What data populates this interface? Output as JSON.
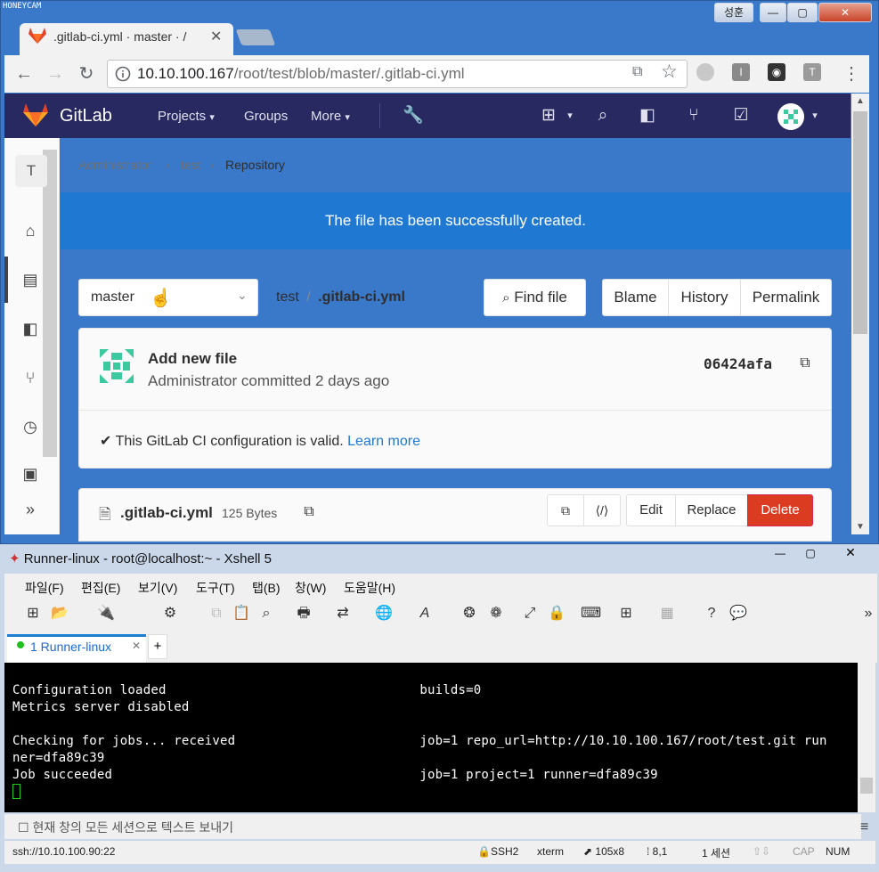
{
  "chrome": {
    "badge": "HONEYCAM",
    "tab_title": ".gitlab-ci.yml · master · /",
    "tab_close": "✕",
    "user_label": "성훈",
    "url_host": "10.10.100.167",
    "url_path": "/root/test/blob/master/.gitlab-ci.yml"
  },
  "gitlab": {
    "brand": "GitLab",
    "nav": [
      "Projects",
      "Groups",
      "More"
    ],
    "sidebar_avatar": "T",
    "breadcrumb": [
      "Administrator",
      "test",
      "Repository"
    ],
    "flash": "The file has been successfully created.",
    "branch": "master",
    "path_project": "test",
    "path_sep": "/",
    "path_file": ".gitlab-ci.yml",
    "find_file": "Find file",
    "blame": "Blame",
    "history": "History",
    "permalink": "Permalink",
    "commit_title": "Add new file",
    "commit_sub": "Administrator committed 2 days ago",
    "sha": "06424afa",
    "ci_text": "This GitLab CI configuration is valid.",
    "ci_link": "Learn more",
    "file_name": ".gitlab-ci.yml",
    "file_size": "125 Bytes",
    "edit": "Edit",
    "replace": "Replace",
    "delete": "Delete"
  },
  "xshell": {
    "title": "Runner-linux - root@localhost:~ - Xshell 5",
    "menu": [
      "파일(F)",
      "편집(E)",
      "보기(V)",
      "도구(T)",
      "탭(B)",
      "창(W)",
      "도움말(H)"
    ],
    "tab": "1 Runner-linux",
    "terminal": [
      "Configuration loaded                                 builds=0",
      "Metrics server disabled",
      "",
      "Checking for jobs... received                        job=1 repo_url=http://10.10.100.167/root/test.git run",
      "ner=dfa89c39",
      "Job succeeded                                        job=1 project=1 runner=dfa89c39"
    ],
    "input_hint": "현재 창의 모든 세션으로 텍스트 보내기",
    "status": {
      "ssh": "ssh://10.10.100.90:22",
      "proto": "SSH2",
      "term": "xterm",
      "size": "105x8",
      "pos": "8,1",
      "sessions": "1 세션",
      "caps": "CAP",
      "num": "NUM"
    }
  }
}
